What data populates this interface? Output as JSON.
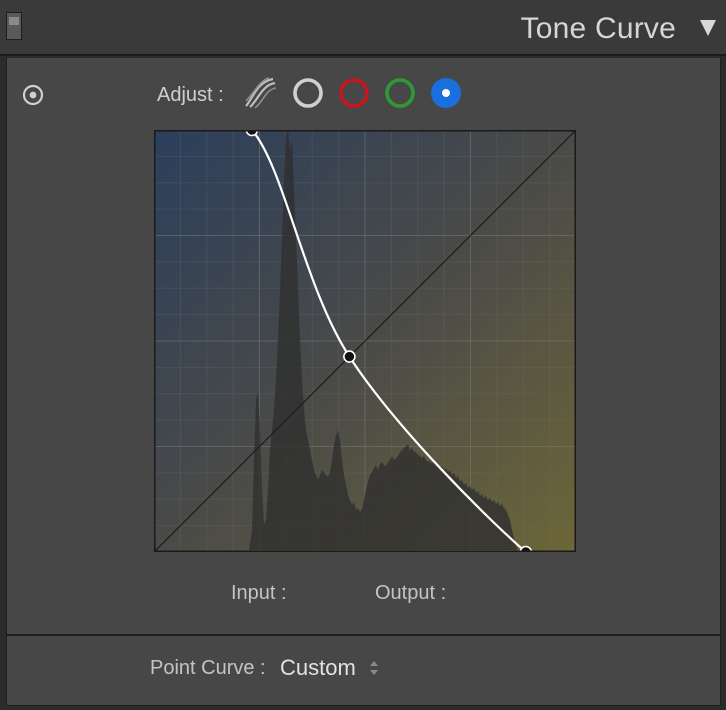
{
  "header": {
    "title": "Tone Curve",
    "toggle_icon": "panel-toggle-icon",
    "collapse_icon": "triangle-down-icon"
  },
  "toolbar": {
    "target_icon": "target-adjustment-icon",
    "adjust_label": "Adjust :",
    "channels": [
      {
        "id": "parametric",
        "icon": "parametric-curve-icon",
        "color": "#bdbdbd"
      },
      {
        "id": "rgb",
        "icon": "rgb-channel-circle-icon",
        "color": "#d0d0d0"
      },
      {
        "id": "red",
        "icon": "red-channel-circle-icon",
        "color": "#c8161e"
      },
      {
        "id": "green",
        "icon": "green-channel-circle-icon",
        "color": "#2f9a35"
      },
      {
        "id": "blue",
        "icon": "blue-channel-circle-icon",
        "color": "#1a6fde",
        "selected": true
      }
    ]
  },
  "curve": {
    "points": [
      [
        0.232,
        1.0
      ],
      [
        0.463,
        0.463
      ],
      [
        0.881,
        0.0
      ]
    ],
    "gradient": {
      "top_left": "#2a3e5a",
      "bottom_right": "#6a6438"
    },
    "grid_divisions": 16
  },
  "readout": {
    "input_label": "Input :",
    "output_label": "Output :"
  },
  "footer": {
    "point_curve_label": "Point Curve :",
    "point_curve_value": "Custom",
    "stepper_icon": "up-down-stepper-icon"
  }
}
